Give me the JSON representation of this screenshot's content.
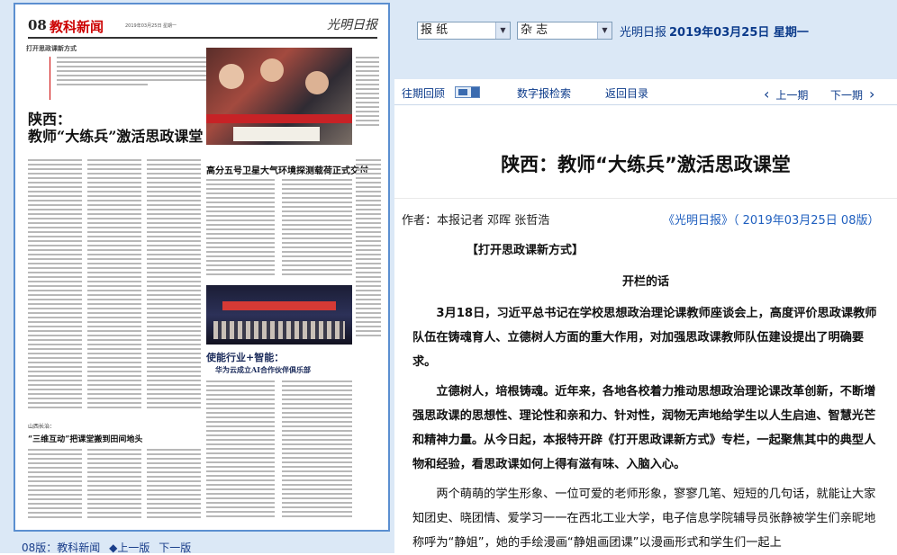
{
  "left_panel": {
    "page": {
      "number": "08",
      "section": "教科新闻",
      "logo": "光明日报",
      "column_tag": "打开思政课新方式",
      "lead_title_line1": "陕西：",
      "lead_title_line2": "教师“大练兵”激活思政课堂",
      "satellite_title": "高分五号卫星大气环境探测载荷正式交付",
      "huawei_title": "使能行业+智能：",
      "huawei_subtitle": "华为云成立AI合作伙伴俱乐部",
      "shanxi_kicker": "山西长治：",
      "shanxi_title": "“三维互动”把课堂搬到田间地头"
    },
    "bottom_nav": {
      "page_label": "08版：教科新闻",
      "prev_page": "上一版",
      "next_page": "下一版"
    }
  },
  "toolbar": {
    "paper_select": "报 纸",
    "magazine_select": "杂 志",
    "paper_name": "光明日报",
    "paper_date": "2019年03月25日  星期一"
  },
  "navbar": {
    "archive": "往期回顾",
    "digital_search": "数字报检索",
    "back_to_index": "返回目录",
    "prev_issue": "上一期",
    "next_issue": "下一期",
    "prev_arrow": "‹",
    "next_arrow": "›"
  },
  "article": {
    "title": "陕西：教师“大练兵”激活思政课堂",
    "author": "作者：本报记者  邓晖  张哲浩",
    "source": "《光明日报》（ 2019年03月25日  08版）",
    "column_tag": "【打开思政课新方式】",
    "opener": "开栏的话",
    "paragraphs": [
      "3月18日，习近平总书记在学校思想政治理论课教师座谈会上，高度评价思政课教师队伍在铸魂育人、立德树人方面的重大作用，对加强思政课教师队伍建设提出了明确要求。",
      "立德树人，培根铸魂。近年来，各地各校着力推动思想政治理论课改革创新，不断增强思政课的思想性、理论性和亲和力、针对性，润物无声地给学生以人生启迪、智慧光芒和精神力量。从今日起，本报特开辟《打开思政课新方式》专栏，一起聚焦其中的典型人物和经验，看思政课如何上得有滋有味、入脑入心。",
      "两个萌萌的学生形象、一位可爱的老师形象，寥寥几笔、短短的几句话，就能让大家知团史、晓团情、爱学习一一在西北工业大学，电子信息学院辅导员张静被学生们亲昵地称呼为“静姐”，她的手绘漫画“静姐画团课”以漫画形式和学生们一起上"
    ]
  }
}
